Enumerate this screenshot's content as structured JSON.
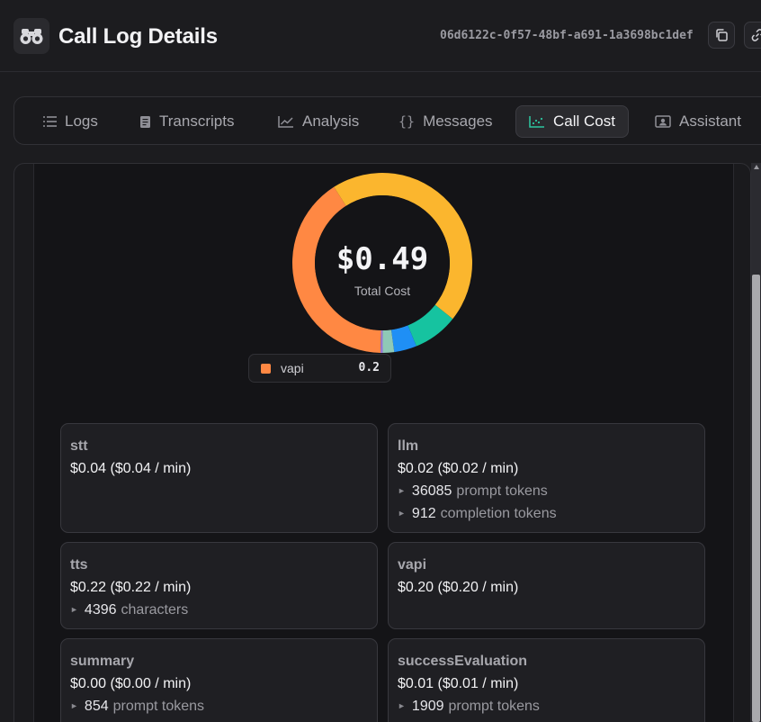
{
  "header": {
    "title": "Call Log Details",
    "call_id": "06d6122c-0f57-48bf-a691-1a3698bc1def"
  },
  "tabs": [
    {
      "label": "Logs",
      "icon": "list-icon"
    },
    {
      "label": "Transcripts",
      "icon": "document-icon"
    },
    {
      "label": "Analysis",
      "icon": "line-chart-icon"
    },
    {
      "label": "Messages",
      "icon": "braces-icon"
    },
    {
      "label": "Call Cost",
      "icon": "scatter-chart-icon",
      "active": true
    },
    {
      "label": "Assistant",
      "icon": "contact-card-icon"
    }
  ],
  "cost": {
    "total": "$0.49",
    "total_label": "Total Cost"
  },
  "chart_data": {
    "type": "pie",
    "subtype": "donut",
    "categories": [
      "vapi",
      "tts",
      "stt",
      "llm",
      "successEvaluation",
      "summary"
    ],
    "values": [
      0.2,
      0.22,
      0.04,
      0.02,
      0.01,
      0.0
    ],
    "colors": [
      "#ff8843",
      "#fbb62e",
      "#16c3a0",
      "#1f8ff5",
      "#8fc9b6",
      "#9a7bd6"
    ],
    "center_label": "$0.49",
    "center_sublabel": "Total Cost"
  },
  "tooltip": {
    "name": "vapi",
    "value": "0.2",
    "color": "#ff8843"
  },
  "cards": [
    {
      "title": "stt",
      "cost": "$0.04 ($0.04 / min)",
      "details": []
    },
    {
      "title": "llm",
      "cost": "$0.02 ($0.02 / min)",
      "details": [
        {
          "value": "36085",
          "label": "prompt tokens"
        },
        {
          "value": "912",
          "label": "completion tokens"
        }
      ]
    },
    {
      "title": "tts",
      "cost": "$0.22 ($0.22 / min)",
      "details": [
        {
          "value": "4396",
          "label": "characters"
        }
      ]
    },
    {
      "title": "vapi",
      "cost": "$0.20 ($0.20 / min)",
      "details": []
    },
    {
      "title": "summary",
      "cost": "$0.00 ($0.00 / min)",
      "details": [
        {
          "value": "854",
          "label": "prompt tokens"
        }
      ]
    },
    {
      "title": "successEvaluation",
      "cost": "$0.01 ($0.01 / min)",
      "details": [
        {
          "value": "1909",
          "label": "prompt tokens"
        }
      ]
    }
  ]
}
